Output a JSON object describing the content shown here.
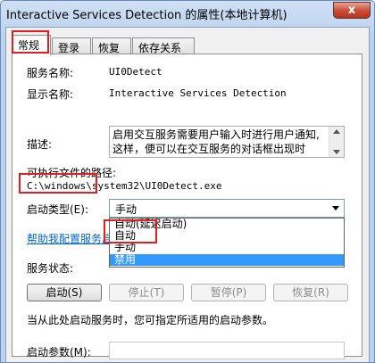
{
  "window": {
    "title": "Interactive Services Detection 的属性(本地计算机)",
    "close_symbol": "x"
  },
  "tabs": [
    {
      "label": "常规",
      "active": true
    },
    {
      "label": "登录",
      "active": false
    },
    {
      "label": "恢复",
      "active": false
    },
    {
      "label": "依存关系",
      "active": false
    }
  ],
  "general": {
    "service_name_label": "服务名称:",
    "service_name_value": "UI0Detect",
    "display_name_label": "显示名称:",
    "display_name_value": "Interactive Services Detection",
    "description_label": "描述:",
    "description_lines": [
      "启用交互服务需要用户输入时进行用户通知,",
      "这样，便可以在交互服务的对话框出现时"
    ],
    "path_label": "可执行文件的路径:",
    "path_value": "C:\\windows\\system32\\UI0Detect.exe",
    "startup_type_label": "启动类型(E):",
    "startup_type_value": "手动",
    "startup_options": [
      "自动(延迟启动)",
      "自动",
      "手动",
      "禁用"
    ],
    "startup_selected_index": 3,
    "help_link": "帮助我配置服务启",
    "service_status_label": "服务状态:",
    "buttons": {
      "start": "启动(S)",
      "stop": "停止(T)",
      "pause": "暂停(P)",
      "resume": "恢复(R)"
    },
    "hint_text": "当从此处启动服务时，您可指定所适用的启动参数。",
    "start_params_label": "启动参数(M):",
    "start_params_value": ""
  },
  "colors": {
    "highlight_box": "#e02020",
    "selected_option": "#3399ff",
    "link": "#0066cc"
  }
}
